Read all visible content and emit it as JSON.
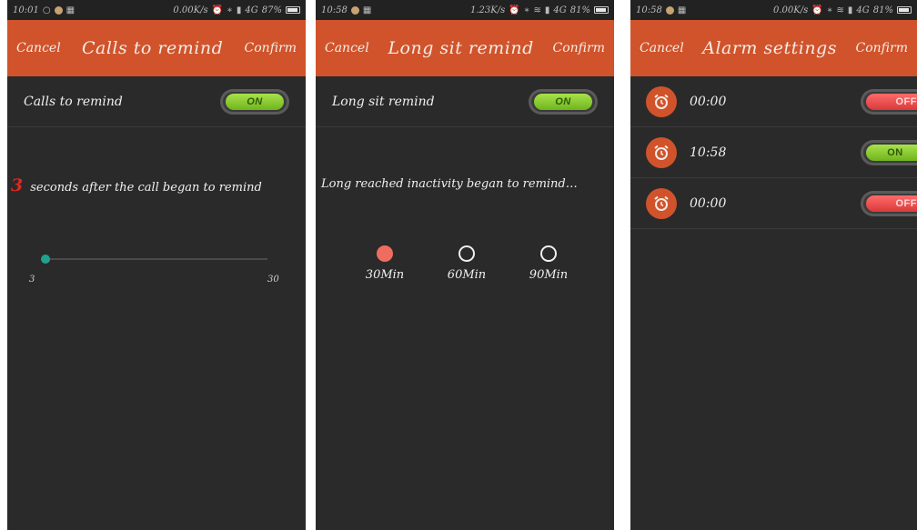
{
  "screens": [
    {
      "status": {
        "time": "10:01",
        "right": "0.00K/s",
        "network": "4G",
        "battery": "87%"
      },
      "header": {
        "cancel": "Cancel",
        "title": "Calls to remind",
        "confirm": "Confirm"
      },
      "toggle_row": {
        "label": "Calls to remind",
        "state": "ON"
      },
      "remind": {
        "seconds": "3",
        "text": "seconds after the call began to remind"
      },
      "slider": {
        "min": "3",
        "max": "30",
        "value": 3
      }
    },
    {
      "status": {
        "time": "10:58",
        "right": "1.23K/s",
        "network": "4G",
        "battery": "81%"
      },
      "header": {
        "cancel": "Cancel",
        "title": "Long sit remind",
        "confirm": "Confirm"
      },
      "toggle_row": {
        "label": "Long sit remind",
        "state": "ON"
      },
      "message": "Long reached inactivity began to remind…",
      "options": [
        {
          "label": "30Min",
          "selected": true
        },
        {
          "label": "60Min",
          "selected": false
        },
        {
          "label": "90Min",
          "selected": false
        }
      ]
    },
    {
      "status": {
        "time": "10:58",
        "right": "0.00K/s",
        "network": "4G",
        "battery": "81%"
      },
      "header": {
        "cancel": "Cancel",
        "title": "Alarm settings",
        "confirm": "Confirm"
      },
      "alarms": [
        {
          "time": "00:00",
          "state": "OFF"
        },
        {
          "time": "10:58",
          "state": "ON"
        },
        {
          "time": "00:00",
          "state": "OFF"
        }
      ]
    }
  ],
  "icons": {
    "alarm": "alarm-clock-icon",
    "bluetooth": "bluetooth-icon",
    "wifi": "wifi-icon",
    "battery": "battery-icon"
  },
  "colors": {
    "header": "#d0532b",
    "background": "#2a2a2a",
    "switch_on": "#8dcb36",
    "switch_off": "#e84a4a",
    "radio_selected": "#ee6d5f",
    "slider_thumb": "#21a18f",
    "seconds_number": "#e0271f"
  }
}
